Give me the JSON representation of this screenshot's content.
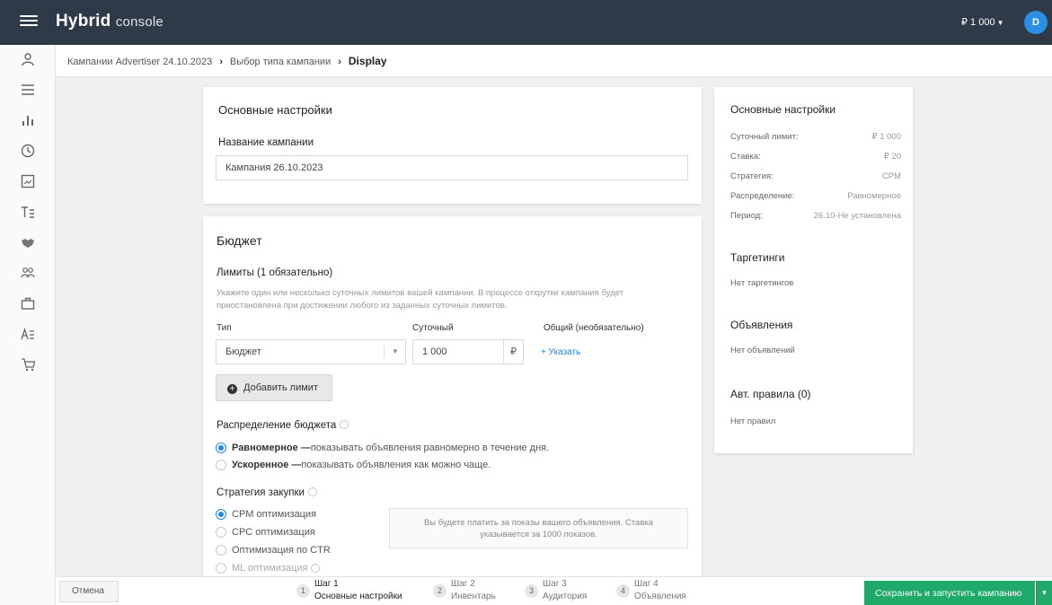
{
  "app": {
    "logo_main": "Hybrid",
    "logo_sub": "console",
    "balance": "₽ 1 000",
    "avatar_initial": "D"
  },
  "breadcrumb": {
    "items": [
      "Кампании Advertiser 24.10.2023",
      "Выбор типа кампании"
    ],
    "current": "Display"
  },
  "basic_settings": {
    "title": "Основные настройки",
    "name_label": "Название кампании",
    "name_value": "Кампания 26.10.2023"
  },
  "budget": {
    "title": "Бюджет",
    "limits_label": "Лимиты (1 обязательно)",
    "limits_hint": "Укажите один или несколько суточных лимитов вашей кампании. В процессе открутки кампания будет приостановлена при достижении любого из заданных суточных лимитов.",
    "col_type": "Тип",
    "col_daily": "Суточный",
    "col_total": "Общий (необязательно)",
    "type_value": "Бюджет",
    "daily_value": "1 000",
    "currency": "₽",
    "specify_link": "+ Указать",
    "add_limit_button": "Добавить лимит",
    "distribution_label": "Распределение бюджета",
    "distribution_options": [
      {
        "bold": "Равномерное —",
        "text": " показывать объявления равномерно в течение дня.",
        "selected": true
      },
      {
        "bold": "Ускоренное —",
        "text": " показывать объявления как можно чаще.",
        "selected": false
      }
    ],
    "strategy_label": "Стратегия закупки",
    "strategy_options": [
      {
        "label": "CPM оптимизация",
        "selected": true
      },
      {
        "label": "CPC оптимизация",
        "selected": false
      },
      {
        "label": "Оптимизация по CTR",
        "selected": false
      },
      {
        "label": "ML оптимизация",
        "selected": false
      }
    ],
    "strategy_info": "Вы будете платить за показы вашего объявления. Ставка указывается за 1000 показов."
  },
  "summary": {
    "title": "Основные настройки",
    "rows": [
      {
        "label": "Суточный лимит:",
        "value": "₽ 1 000"
      },
      {
        "label": "Ставка:",
        "value": "₽ 20"
      },
      {
        "label": "Стратегия:",
        "value": "CPM"
      },
      {
        "label": "Распределение:",
        "value": "Равномерное"
      },
      {
        "label": "Период:",
        "value": "26.10-Не установлена"
      }
    ],
    "targeting_title": "Таргетинги",
    "targeting_value": "Нет таргетингов",
    "ads_title": "Объявления",
    "ads_value": "Нет объявлений",
    "rules_title": "Авт. правила (0)",
    "rules_value": "Нет правил"
  },
  "footer": {
    "cancel": "Отмена",
    "steps": [
      {
        "num": "1",
        "label": "Шаг 1",
        "sub": "Основные настройки",
        "active": true
      },
      {
        "num": "2",
        "label": "Шаг 2",
        "sub": "Инвентарь",
        "active": false
      },
      {
        "num": "3",
        "label": "Шаг 3",
        "sub": "Аудитория",
        "active": false
      },
      {
        "num": "4",
        "label": "Шаг 4",
        "sub": "Объявления",
        "active": false
      }
    ],
    "save_button": "Сохранить и запустить кампанию"
  },
  "colors": {
    "topbar": "#2e3a48",
    "accent": "#1e88e5",
    "save": "#1faa6a"
  },
  "icons": [
    "menu-icon",
    "user-icon",
    "list-icon",
    "bar-chart-icon",
    "clock-icon",
    "image-icon",
    "text-icon",
    "handshake-icon",
    "users-icon",
    "briefcase-icon",
    "translate-icon",
    "cart-icon",
    "plus-circle-icon",
    "info-icon",
    "chevron-down-icon"
  ]
}
